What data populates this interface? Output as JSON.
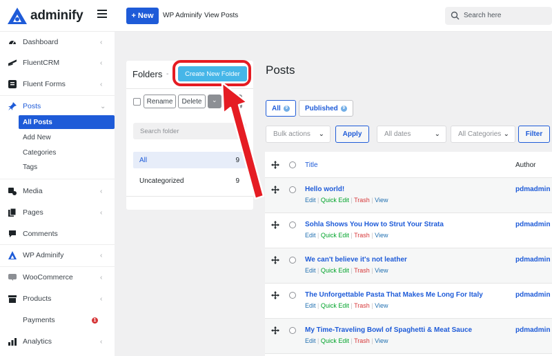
{
  "brand": {
    "name": "adminify"
  },
  "topbar": {
    "new_label": "New",
    "links": [
      "WP Adminify",
      "View Posts"
    ],
    "search_placeholder": "Search here"
  },
  "sidebar": {
    "items": [
      {
        "label": "Dashboard",
        "icon": "dashboard-icon"
      },
      {
        "label": "FluentCRM",
        "icon": "fluentcrm-icon"
      },
      {
        "label": "Fluent Forms",
        "icon": "forms-icon"
      },
      {
        "label": "Posts",
        "icon": "pin-icon"
      },
      {
        "label": "Media",
        "icon": "media-icon"
      },
      {
        "label": "Pages",
        "icon": "pages-icon"
      },
      {
        "label": "Comments",
        "icon": "comment-icon"
      },
      {
        "label": "WP Adminify",
        "icon": "adminify-icon"
      },
      {
        "label": "WooCommerce",
        "icon": "woocommerce-icon"
      },
      {
        "label": "Products",
        "icon": "products-icon"
      },
      {
        "label": "Payments",
        "icon": "payments-icon",
        "badge": "1"
      },
      {
        "label": "Analytics",
        "icon": "analytics-icon"
      }
    ],
    "posts_submenu": [
      "All Posts",
      "Add New",
      "Categories",
      "Tags"
    ]
  },
  "folders": {
    "title": "Folders",
    "dash": "-",
    "create_label": "Create New Folder",
    "rename_label": "Rename",
    "delete_label": "Delete",
    "search_placeholder": "Search folder",
    "list": [
      {
        "name": "All",
        "count": "9"
      },
      {
        "name": "Uncategorized",
        "count": "9"
      }
    ]
  },
  "posts": {
    "title": "Posts",
    "filters": [
      {
        "label": "All",
        "count": "9"
      },
      {
        "label": "Published",
        "count": "9"
      }
    ],
    "bulk_actions": "Bulk actions",
    "apply_label": "Apply",
    "all_dates": "All dates",
    "all_categories": "All Categories",
    "filter_label": "Filter",
    "columns": {
      "title": "Title",
      "author": "Author"
    },
    "row_actions": {
      "edit": "Edit",
      "quick_edit": "Quick Edit",
      "trash": "Trash",
      "view": "View",
      "sep": "|"
    },
    "rows": [
      {
        "title": "Hello world!",
        "author": "pdmadmin"
      },
      {
        "title": "Sohla Shows You How to Strut Your Strata",
        "author": "pdmadmin"
      },
      {
        "title": "We can't believe it's not leather",
        "author": "pdmadmin"
      },
      {
        "title": "The Unforgettable Pasta That Makes Me Long For Italy",
        "author": "pdmadmin"
      },
      {
        "title": "My Time-Traveling Bowl of Spaghetti & Meat Sauce",
        "author": "pdmadmin"
      }
    ]
  },
  "colors": {
    "accent": "#1e5bd8",
    "create_button": "#46b6e8",
    "highlight": "#e51c23"
  }
}
